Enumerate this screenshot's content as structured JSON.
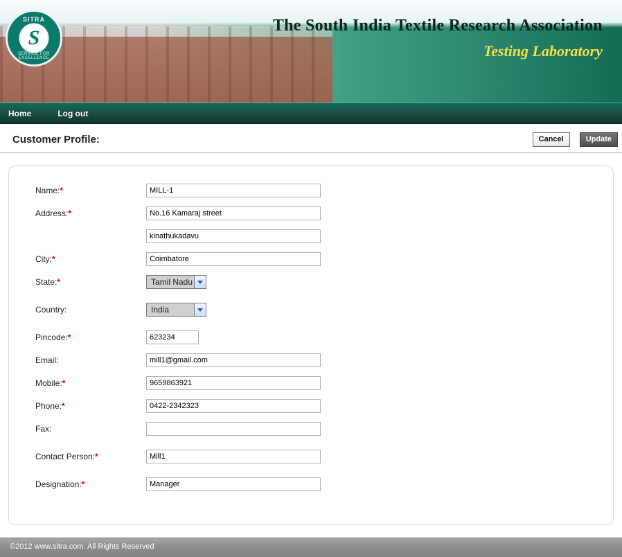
{
  "banner": {
    "logo_top": "SITRA",
    "logo_bottom": "SERVICE FOR EXCELLENCE",
    "logo_letter": "S",
    "title": "The South India Textile Research Association",
    "subtitle": "Testing Laboratory"
  },
  "nav": {
    "home": "Home",
    "logout": "Log out"
  },
  "head": {
    "title": "Customer Profile:",
    "cancel": "Cancel",
    "update": "Update"
  },
  "labels": {
    "name": "Name:",
    "address": "Address:",
    "city": "City:",
    "state": "State:",
    "country": "Country:",
    "pincode": "Pincode:",
    "email": "Email:",
    "mobile": "Mobile:",
    "phone": "Phone:",
    "fax": "Fax:",
    "contact": "Contact Person:",
    "designation": "Designation:"
  },
  "form": {
    "name": "MILL-1",
    "address1": "No.16 Kamaraj street",
    "address2": "kinathukadavu",
    "city": "Coimbatore",
    "state": "Tamil Nadu",
    "country": "India",
    "pincode": "623234",
    "email": "mill1@gmail.com",
    "mobile": "9659863921",
    "phone": "0422-2342323",
    "fax": "",
    "contact": "Mill1",
    "designation": "Manager"
  },
  "footer": "©2012 www.sitra.com. All Rights Reserved"
}
